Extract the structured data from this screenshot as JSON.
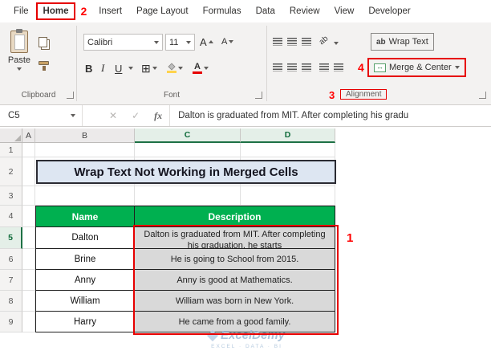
{
  "colors": {
    "accent_green": "#217346",
    "table_header_green": "#00b050",
    "annotation_red": "#ff0000",
    "title_fill": "#dde6f2",
    "desc_fill": "#d9d9d9"
  },
  "ribbon": {
    "tabs": [
      "File",
      "Home",
      "Insert",
      "Page Layout",
      "Formulas",
      "Data",
      "Review",
      "View",
      "Developer"
    ],
    "clipboard": {
      "group_label": "Clipboard",
      "paste_label": "Paste"
    },
    "font": {
      "group_label": "Font",
      "font_name": "Calibri",
      "font_size": "11",
      "bold": "B",
      "italic": "I",
      "underline": "U",
      "borders_glyph": "⊞",
      "fontcolor_glyph": "A"
    },
    "alignment": {
      "group_label": "Alignment",
      "wrap_text_label": "Wrap Text",
      "ab_glyph": "ab",
      "merge_center_label": "Merge & Center"
    }
  },
  "formula_bar": {
    "name_box": "C5",
    "cancel_glyph": "✕",
    "enter_glyph": "✓",
    "fx_glyph": "fx",
    "formula_text": "Dalton is graduated from MIT. After completing his gradu"
  },
  "annotations": {
    "step1": "1",
    "step2": "2",
    "step3": "3",
    "step4": "4"
  },
  "sheet": {
    "columns": [
      "A",
      "B",
      "C",
      "D"
    ],
    "rows": [
      "1",
      "2",
      "3",
      "4",
      "5",
      "6",
      "7",
      "8",
      "9"
    ],
    "title": "Wrap Text Not Working in Merged Cells",
    "table": {
      "name_header": "Name",
      "desc_header": "Description",
      "rows": [
        {
          "name": "Dalton",
          "description": "Dalton is graduated from MIT. After completing his graduation, he starts"
        },
        {
          "name": "Brine",
          "description": "He is going to School from 2015."
        },
        {
          "name": "Anny",
          "description": "Anny is good at Mathematics."
        },
        {
          "name": "William",
          "description": "William was born in New York."
        },
        {
          "name": "Harry",
          "description": "He came from a good family."
        }
      ]
    }
  },
  "watermark": {
    "brand": "ExcelDemy",
    "tagline": "EXCEL · DATA · BI"
  }
}
